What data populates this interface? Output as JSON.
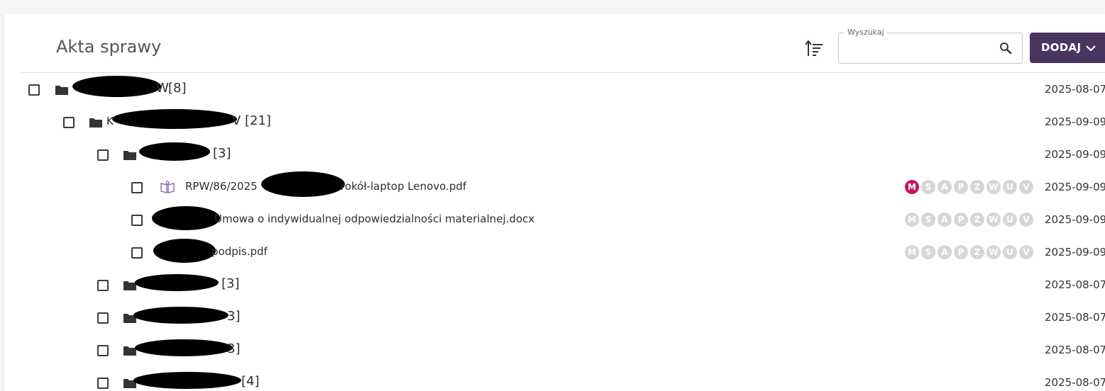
{
  "header": {
    "title": "Akta sprawy",
    "search": {
      "label": "Wyszukaj",
      "value": "",
      "placeholder": ""
    },
    "add_button": "DODAJ"
  },
  "rows": [
    {
      "kind": "folder",
      "name_visible": "W",
      "count": "[8]",
      "date": "2025-08-07"
    },
    {
      "kind": "folder",
      "name_visible_start": "K",
      "name_visible_end": "V",
      "count": "[21]",
      "date": "2025-09-09"
    },
    {
      "kind": "folder",
      "count": "[3]",
      "date": "2025-09-09"
    },
    {
      "kind": "file",
      "name_start": "RPW/86/2025",
      "name_end": "rokół-laptop Lenovo.pdf",
      "date": "2025-09-09",
      "badges": [
        "M",
        "S",
        "A",
        "P",
        "Z",
        "W",
        "U",
        "V"
      ],
      "active_badge": "M"
    },
    {
      "kind": "file",
      "name_end": "Umowa o indywidualnej odpowiedzialności materialnej.docx",
      "date": "2025-09-09",
      "badges": [
        "M",
        "S",
        "A",
        "P",
        "Z",
        "W",
        "U",
        "V"
      ],
      "active_badge": ""
    },
    {
      "kind": "file",
      "name_end": "podpis.pdf",
      "date": "2025-09-09",
      "badges": [
        "M",
        "S",
        "A",
        "P",
        "Z",
        "W",
        "U",
        "V"
      ],
      "active_badge": ""
    },
    {
      "kind": "folder",
      "count": "[3]",
      "date": "2025-08-07"
    },
    {
      "kind": "folder",
      "count": "3]",
      "date": "2025-08-07"
    },
    {
      "kind": "folder",
      "count": "3]",
      "date": "2025-08-07"
    },
    {
      "kind": "folder",
      "count": "[4]",
      "date": "2025-08-07"
    }
  ],
  "colors": {
    "accent": "#4b3460",
    "badge_active": "#c2185b",
    "badge_inactive": "#d6d6d6"
  }
}
